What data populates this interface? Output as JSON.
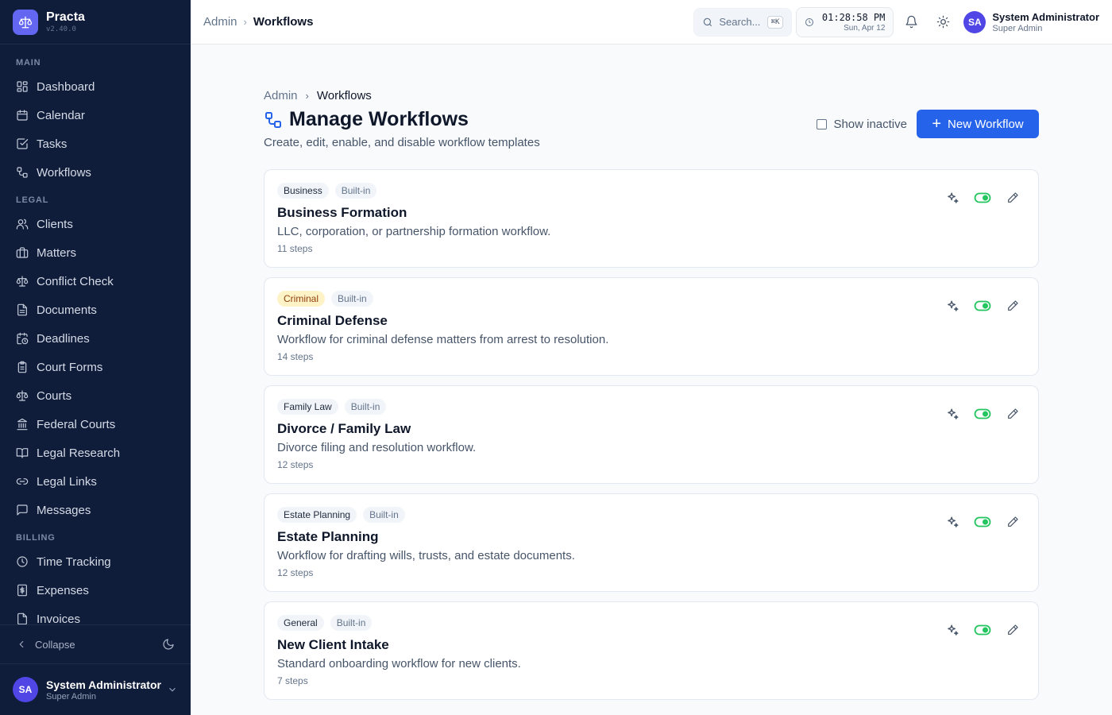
{
  "brand": {
    "name": "Practa",
    "version": "v2.40.0"
  },
  "sidebar": {
    "sections": [
      {
        "label": "MAIN",
        "items": [
          {
            "label": "Dashboard",
            "icon": "dashboard-icon"
          },
          {
            "label": "Calendar",
            "icon": "calendar-icon"
          },
          {
            "label": "Tasks",
            "icon": "tasks-icon"
          },
          {
            "label": "Workflows",
            "icon": "workflow-icon"
          }
        ]
      },
      {
        "label": "LEGAL",
        "items": [
          {
            "label": "Clients",
            "icon": "users-icon"
          },
          {
            "label": "Matters",
            "icon": "briefcase-icon"
          },
          {
            "label": "Conflict Check",
            "icon": "scale-icon"
          },
          {
            "label": "Documents",
            "icon": "document-icon"
          },
          {
            "label": "Deadlines",
            "icon": "calendar-clock-icon"
          },
          {
            "label": "Court Forms",
            "icon": "clipboard-icon"
          },
          {
            "label": "Courts",
            "icon": "scale-icon"
          },
          {
            "label": "Federal Courts",
            "icon": "landmark-icon"
          },
          {
            "label": "Legal Research",
            "icon": "book-icon"
          },
          {
            "label": "Legal Links",
            "icon": "link-icon"
          },
          {
            "label": "Messages",
            "icon": "message-icon"
          }
        ]
      },
      {
        "label": "BILLING",
        "items": [
          {
            "label": "Time Tracking",
            "icon": "clock-icon"
          },
          {
            "label": "Expenses",
            "icon": "receipt-icon"
          },
          {
            "label": "Invoices",
            "icon": "invoice-icon"
          }
        ]
      }
    ],
    "collapse_label": "Collapse",
    "user": {
      "initials": "SA",
      "name": "System Administrator",
      "role": "Super Admin"
    }
  },
  "topbar": {
    "breadcrumb": {
      "parent": "Admin",
      "current": "Workflows"
    },
    "search": {
      "placeholder": "Search...",
      "shortcut": "⌘K"
    },
    "clock": {
      "time": "01:28:58 PM",
      "date": "Sun, Apr 12"
    },
    "user": {
      "initials": "SA",
      "name": "System Administrator",
      "role": "Super Admin"
    }
  },
  "page": {
    "breadcrumb": {
      "parent": "Admin",
      "current": "Workflows"
    },
    "title": "Manage Workflows",
    "subtitle": "Create, edit, enable, and disable workflow templates",
    "show_inactive_label": "Show inactive",
    "new_button_label": "New Workflow"
  },
  "workflows": [
    {
      "category": "Business",
      "category_color": "#f1f5f9",
      "builtin": "Built-in",
      "title": "Business Formation",
      "description": "LLC, corporation, or partnership formation workflow.",
      "steps": "11 steps",
      "enabled": true
    },
    {
      "category": "Criminal",
      "category_color": "#fef3c7",
      "builtin": "Built-in",
      "title": "Criminal Defense",
      "description": "Workflow for criminal defense matters from arrest to resolution.",
      "steps": "14 steps",
      "enabled": true
    },
    {
      "category": "Family Law",
      "category_color": "#f1f5f9",
      "builtin": "Built-in",
      "title": "Divorce / Family Law",
      "description": "Divorce filing and resolution workflow.",
      "steps": "12 steps",
      "enabled": true
    },
    {
      "category": "Estate Planning",
      "category_color": "#f1f5f9",
      "builtin": "Built-in",
      "title": "Estate Planning",
      "description": "Workflow for drafting wills, trusts, and estate documents.",
      "steps": "12 steps",
      "enabled": true
    },
    {
      "category": "General",
      "category_color": "#f1f5f9",
      "builtin": "Built-in",
      "title": "New Client Intake",
      "description": "Standard onboarding workflow for new clients.",
      "steps": "7 steps",
      "enabled": true
    }
  ],
  "colors": {
    "sidebar_bg": "#0f1c3a",
    "accent": "#2563eb",
    "brand": "#6366f1",
    "toggle_on": "#22c55e"
  }
}
